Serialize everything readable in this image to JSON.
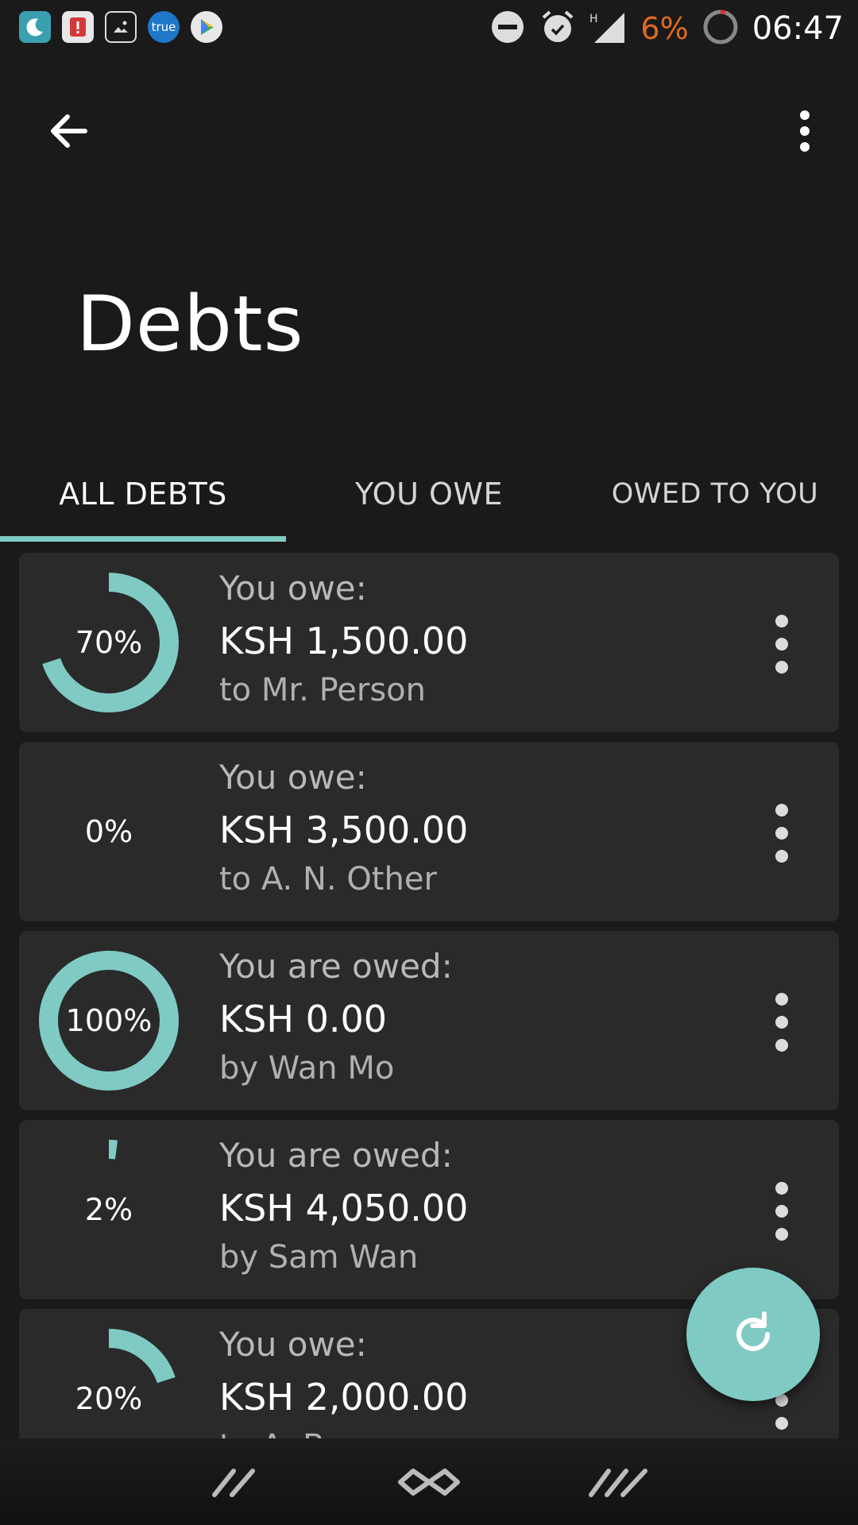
{
  "status_bar": {
    "time": "06:47",
    "battery_percent": "6%",
    "apps": [
      {
        "icon": "moon-app-icon",
        "color": "#3aa0b0"
      },
      {
        "icon": "alert-app-icon",
        "color": "#d23a3a"
      },
      {
        "icon": "gallery-app-icon",
        "color": "#555555"
      },
      {
        "icon": "true-app-icon",
        "color": "#1e77c9",
        "text": "true"
      },
      {
        "icon": "play-store-icon",
        "color": "#555555"
      }
    ],
    "icons": [
      "do-not-disturb-icon",
      "alarm-icon",
      "signal-icon",
      "battery-icon"
    ]
  },
  "toolbar": {
    "back_icon": "arrow-back-icon",
    "overflow_icon": "more-vert-icon"
  },
  "page": {
    "title": "Debts"
  },
  "tabs": [
    {
      "label": "ALL DEBTS",
      "active": true
    },
    {
      "label": "YOU OWE",
      "active": false
    },
    {
      "label": "OWED TO YOU",
      "active": false
    }
  ],
  "colors": {
    "accent": "#7fcbc4",
    "background": "#1a1a1a",
    "card": "#2a2a2a"
  },
  "debts": [
    {
      "percent": "70%",
      "progress": 0.7,
      "heading": "You owe:",
      "amount": "KSH 1,500.00",
      "party": "to Mr. Person"
    },
    {
      "percent": "0%",
      "progress": 0.0,
      "heading": "You owe:",
      "amount": "KSH 3,500.00",
      "party": "to A. N. Other"
    },
    {
      "percent": "100%",
      "progress": 1.0,
      "heading": "You are owed:",
      "amount": "KSH 0.00",
      "party": "by Wan Mo"
    },
    {
      "percent": "2%",
      "progress": 0.02,
      "heading": "You are owed:",
      "amount": "KSH 4,050.00",
      "party": "by Sam Wan"
    },
    {
      "percent": "20%",
      "progress": 0.2,
      "heading": "You owe:",
      "amount": "KSH 2,000.00",
      "party": "to A. B"
    }
  ],
  "fab": {
    "icon": "refresh-icon"
  },
  "bottom_nav": [
    "nav-back-icon",
    "nav-home-icon",
    "nav-recents-icon"
  ]
}
